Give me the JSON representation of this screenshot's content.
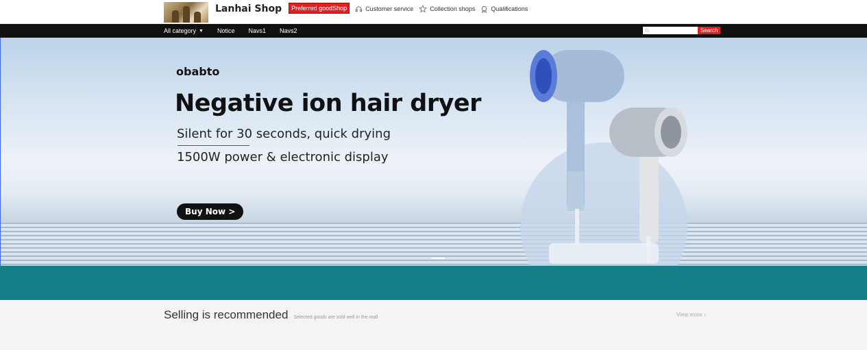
{
  "header": {
    "shop_name": "Lanhai Shop",
    "badge": "Preferred goodShop",
    "links": [
      {
        "icon": "headset-icon",
        "label": "Customer service"
      },
      {
        "icon": "star-icon",
        "label": "Collection shops"
      },
      {
        "icon": "ribbon-icon",
        "label": "Qualifications"
      }
    ]
  },
  "nav": {
    "items": [
      "All category",
      "Notice",
      "Navs1",
      "Navs2"
    ],
    "search_placeholder": "",
    "search_button": "Search"
  },
  "banner": {
    "brand": "obabto",
    "headline": "Negative ion hair dryer",
    "sub1": "Silent for 30 seconds, quick drying",
    "sub2": "1500W power & electronic display",
    "cta": "Buy Now >"
  },
  "recommend": {
    "title": "Selling is recommended",
    "subtitle": "Selected goods are sold well in the mall",
    "view_more": "View more ›"
  },
  "colors": {
    "accent_red": "#e02020",
    "nav_bg": "#111111",
    "teal": "#137f86"
  }
}
